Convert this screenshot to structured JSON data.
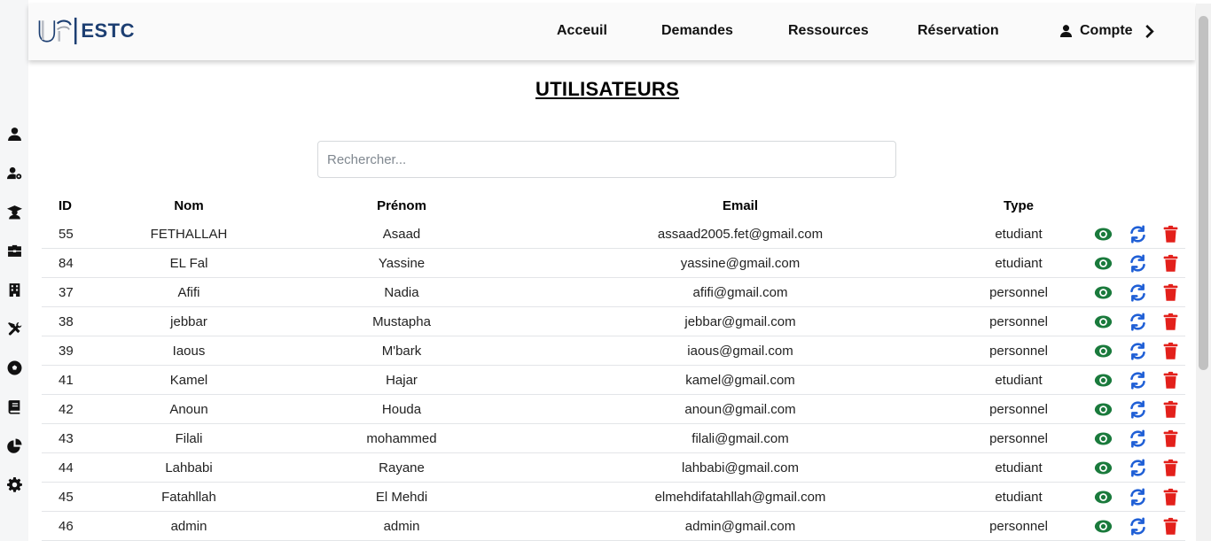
{
  "brand": {
    "logo_text": "ESTC"
  },
  "nav": {
    "items": [
      "Acceuil",
      "Demandes",
      "Ressources",
      "Réservation"
    ],
    "account": "Compte"
  },
  "sidebar": {
    "icons": [
      "user-icon",
      "user-gear-icon",
      "graduate-icon",
      "briefcase-icon",
      "building-icon",
      "tools-icon",
      "soccer-ball-icon",
      "book-icon",
      "pie-chart-icon",
      "gear-icon"
    ]
  },
  "page": {
    "title": "UTILISATEURS"
  },
  "search": {
    "placeholder": "Rechercher..."
  },
  "table": {
    "headers": {
      "id": "ID",
      "nom": "Nom",
      "prenom": "Prénom",
      "email": "Email",
      "type": "Type"
    },
    "rows": [
      {
        "id": "55",
        "nom": "FETHALLAH",
        "prenom": "Asaad",
        "email": "assaad2005.fet@gmail.com",
        "type": "etudiant"
      },
      {
        "id": "84",
        "nom": "EL Fal",
        "prenom": "Yassine",
        "email": "yassine@gmail.com",
        "type": "etudiant"
      },
      {
        "id": "37",
        "nom": "Afifi",
        "prenom": "Nadia",
        "email": "afifi@gmail.com",
        "type": "personnel"
      },
      {
        "id": "38",
        "nom": "jebbar",
        "prenom": "Mustapha",
        "email": "jebbar@gmail.com",
        "type": "personnel"
      },
      {
        "id": "39",
        "nom": "Iaous",
        "prenom": "M'bark",
        "email": "iaous@gmail.com",
        "type": "personnel"
      },
      {
        "id": "41",
        "nom": "Kamel",
        "prenom": "Hajar",
        "email": "kamel@gmail.com",
        "type": "etudiant"
      },
      {
        "id": "42",
        "nom": "Anoun",
        "prenom": "Houda",
        "email": "anoun@gmail.com",
        "type": "personnel"
      },
      {
        "id": "43",
        "nom": "Filali",
        "prenom": "mohammed",
        "email": "filali@gmail.com",
        "type": "personnel"
      },
      {
        "id": "44",
        "nom": "Lahbabi",
        "prenom": "Rayane",
        "email": "lahbabi@gmail.com",
        "type": "etudiant"
      },
      {
        "id": "45",
        "nom": "Fatahllah",
        "prenom": "El Mehdi",
        "email": "elmehdifatahllah@gmail.com",
        "type": "etudiant"
      },
      {
        "id": "46",
        "nom": "admin",
        "prenom": "admin",
        "email": "admin@gmail.com",
        "type": "personnel"
      }
    ],
    "actions": [
      "eye-icon",
      "sync-icon",
      "trash-icon"
    ]
  },
  "colors": {
    "view": "#1a7a3c",
    "sync": "#1f5fd6",
    "delete": "#e3201b",
    "brand": "#1d3f72"
  }
}
